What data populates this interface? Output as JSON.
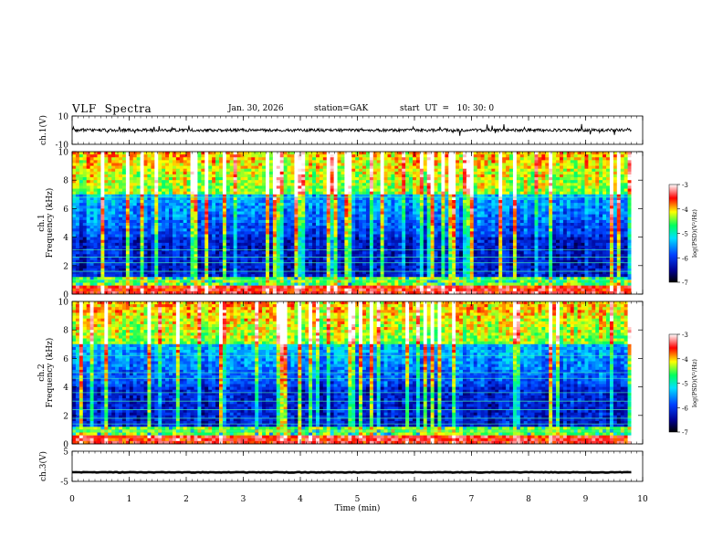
{
  "header": {
    "title": "VLF  Spectra",
    "date": "Jan. 30, 2026",
    "station": "station=GAK",
    "start": "start  UT  =   10: 30: 0"
  },
  "chart_data": [
    {
      "type": "line",
      "panel": "ch1-waveform",
      "ylabel": "ch.1(V)",
      "ylim": [
        -10,
        10
      ],
      "yticks": [
        "10",
        "-10"
      ],
      "description_values": {
        "mean": 0,
        "amplitude_approx": 2
      },
      "x_range": [
        0,
        9.8
      ]
    },
    {
      "type": "heatmap",
      "panel": "ch1-spectrogram",
      "ylabel": "ch.1\nFrequency  (kHz)",
      "ylim": [
        0,
        10
      ],
      "yticks": [
        "0",
        "2",
        "4",
        "6",
        "8",
        "10"
      ],
      "colorbar": {
        "label": "log(PSD)(V²/Hz)",
        "range": [
          -7,
          -3
        ],
        "ticks": [
          "-3",
          "-4",
          "-5",
          "-6",
          "-7"
        ]
      },
      "x_range": [
        0,
        9.8
      ]
    },
    {
      "type": "heatmap",
      "panel": "ch2-spectrogram",
      "ylabel": "ch.2\nFrequency  (kHz)",
      "ylim": [
        0,
        10
      ],
      "yticks": [
        "0",
        "2",
        "4",
        "6",
        "8",
        "10"
      ],
      "colorbar": {
        "label": "log(PSD)(V²/Hz)",
        "range": [
          -7,
          -3
        ],
        "ticks": [
          "-3",
          "-4",
          "-5",
          "-6",
          "-7"
        ]
      },
      "x_range": [
        0,
        9.8
      ]
    },
    {
      "type": "line",
      "panel": "ch3-waveform",
      "ylabel": "ch.3(V)",
      "ylim": [
        -5,
        5
      ],
      "yticks": [
        "5",
        "-5"
      ],
      "description_values": {
        "mean": -2,
        "amplitude_approx": 0.2
      },
      "x_range": [
        0,
        9.8
      ]
    }
  ],
  "xaxis": {
    "label": "Time  (min)",
    "xlim": [
      0,
      10
    ],
    "ticks": [
      "0",
      "1",
      "2",
      "3",
      "4",
      "5",
      "6",
      "7",
      "8",
      "9",
      "10"
    ]
  }
}
